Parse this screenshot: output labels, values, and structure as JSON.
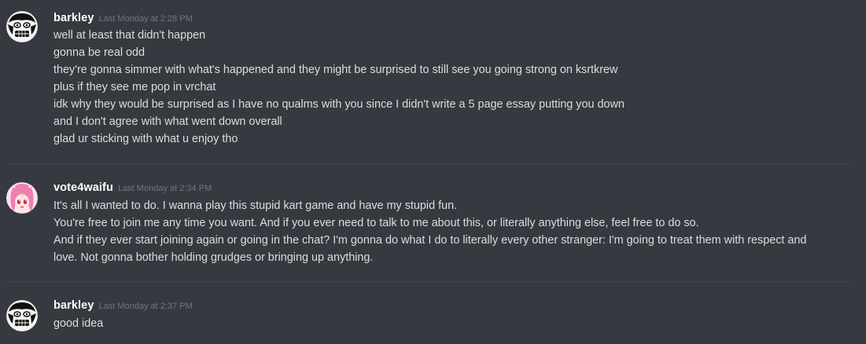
{
  "messages": [
    {
      "username": "barkley",
      "timestamp": "Last Monday at 2:28 PM",
      "avatar_icon": "grimacing-face-avatar",
      "lines": [
        "well at least that didn't happen",
        "gonna be real odd",
        "they're gonna simmer with what's happened and they might be surprised to still see you going strong on ksrtkrew",
        "plus if they see me pop in vrchat",
        "idk why they would be surprised as I have no qualms with you since I didn't write a 5 page essay putting you down",
        "and I don't agree with what went down overall",
        "glad ur sticking with what u enjoy tho"
      ]
    },
    {
      "username": "vote4waifu",
      "timestamp": "Last Monday at 2:34 PM",
      "avatar_icon": "pink-haired-anime-girl-avatar",
      "lines": [
        "It's all I wanted to do. I wanna play this stupid kart game and have my stupid fun.",
        "You're free to join me any time you want. And if you ever need to talk to me about this, or literally anything else, feel free to do so.",
        "And if they ever start joining again or going in the chat? I'm gonna do what I do to literally every other stranger: I'm going to treat them with respect and",
        "love. Not gonna bother holding grudges or bringing up anything."
      ]
    },
    {
      "username": "barkley",
      "timestamp": "Last Monday at 2:37 PM",
      "avatar_icon": "grimacing-face-avatar",
      "lines": [
        "good idea"
      ]
    }
  ],
  "colors": {
    "background": "#36393f",
    "username": "#ffffff",
    "timestamp": "#72767d",
    "message_text": "#dcddde",
    "divider": "#42454a"
  }
}
